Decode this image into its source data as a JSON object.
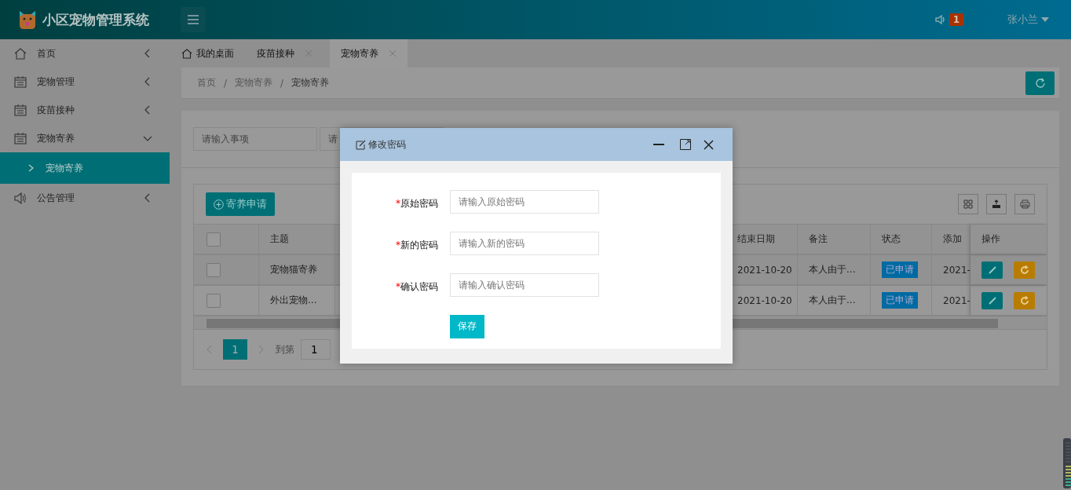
{
  "header": {
    "title": "小区宠物管理系统",
    "badge": "1",
    "user": "张小兰"
  },
  "sidebar": {
    "items": [
      {
        "label": "首页",
        "expanded": false
      },
      {
        "label": "宠物管理",
        "expanded": false
      },
      {
        "label": "疫苗接种",
        "expanded": false
      },
      {
        "label": "宠物寄养",
        "expanded": true,
        "children": [
          {
            "label": "宠物寄养",
            "selected": true
          }
        ]
      },
      {
        "label": "公告管理",
        "expanded": false
      }
    ]
  },
  "tabs": [
    {
      "label": "我的桌面",
      "kind": "home",
      "selected": false
    },
    {
      "label": "疫苗接种",
      "kind": "closable",
      "selected": false
    },
    {
      "label": "宠物寄养",
      "kind": "closable",
      "selected": true
    }
  ],
  "breadcrumb": {
    "separator": "/",
    "items": [
      "首页",
      "宠物寄养",
      "宠物寄养"
    ]
  },
  "search": {
    "fields": [
      {
        "placeholder": "请输入事项"
      },
      {
        "placeholder": "请"
      }
    ]
  },
  "toolbar": {
    "add_button": "寄养申请"
  },
  "table": {
    "header_checked": false,
    "columns": [
      "主题",
      "结束日期",
      "备注",
      "状态",
      "添加",
      "操作"
    ],
    "rows": [
      {
        "checked": false,
        "subject": "宠物猫寄养",
        "end_date": "2021-10-20",
        "note": "本人由于...",
        "status": "已申请",
        "added": "2021-"
      },
      {
        "checked": false,
        "subject": "外出宠物...",
        "end_date": "2021-10-20",
        "note": "本人由于...",
        "status": "已申请",
        "added": "2021-"
      }
    ]
  },
  "pagination": {
    "pages": [
      {
        "label": "1",
        "selected": true
      }
    ],
    "goto_label": "到第",
    "goto_value": "1"
  },
  "dialog": {
    "title": "修改密码",
    "fields": [
      {
        "mark": "*",
        "label": "原始密码",
        "placeholder": "请输入原始密码"
      },
      {
        "mark": "*",
        "label": "新的密码",
        "placeholder": "请输入新的密码"
      },
      {
        "mark": "*",
        "label": "确认密码",
        "placeholder": "请输入确认密码"
      }
    ],
    "save": "保存"
  }
}
